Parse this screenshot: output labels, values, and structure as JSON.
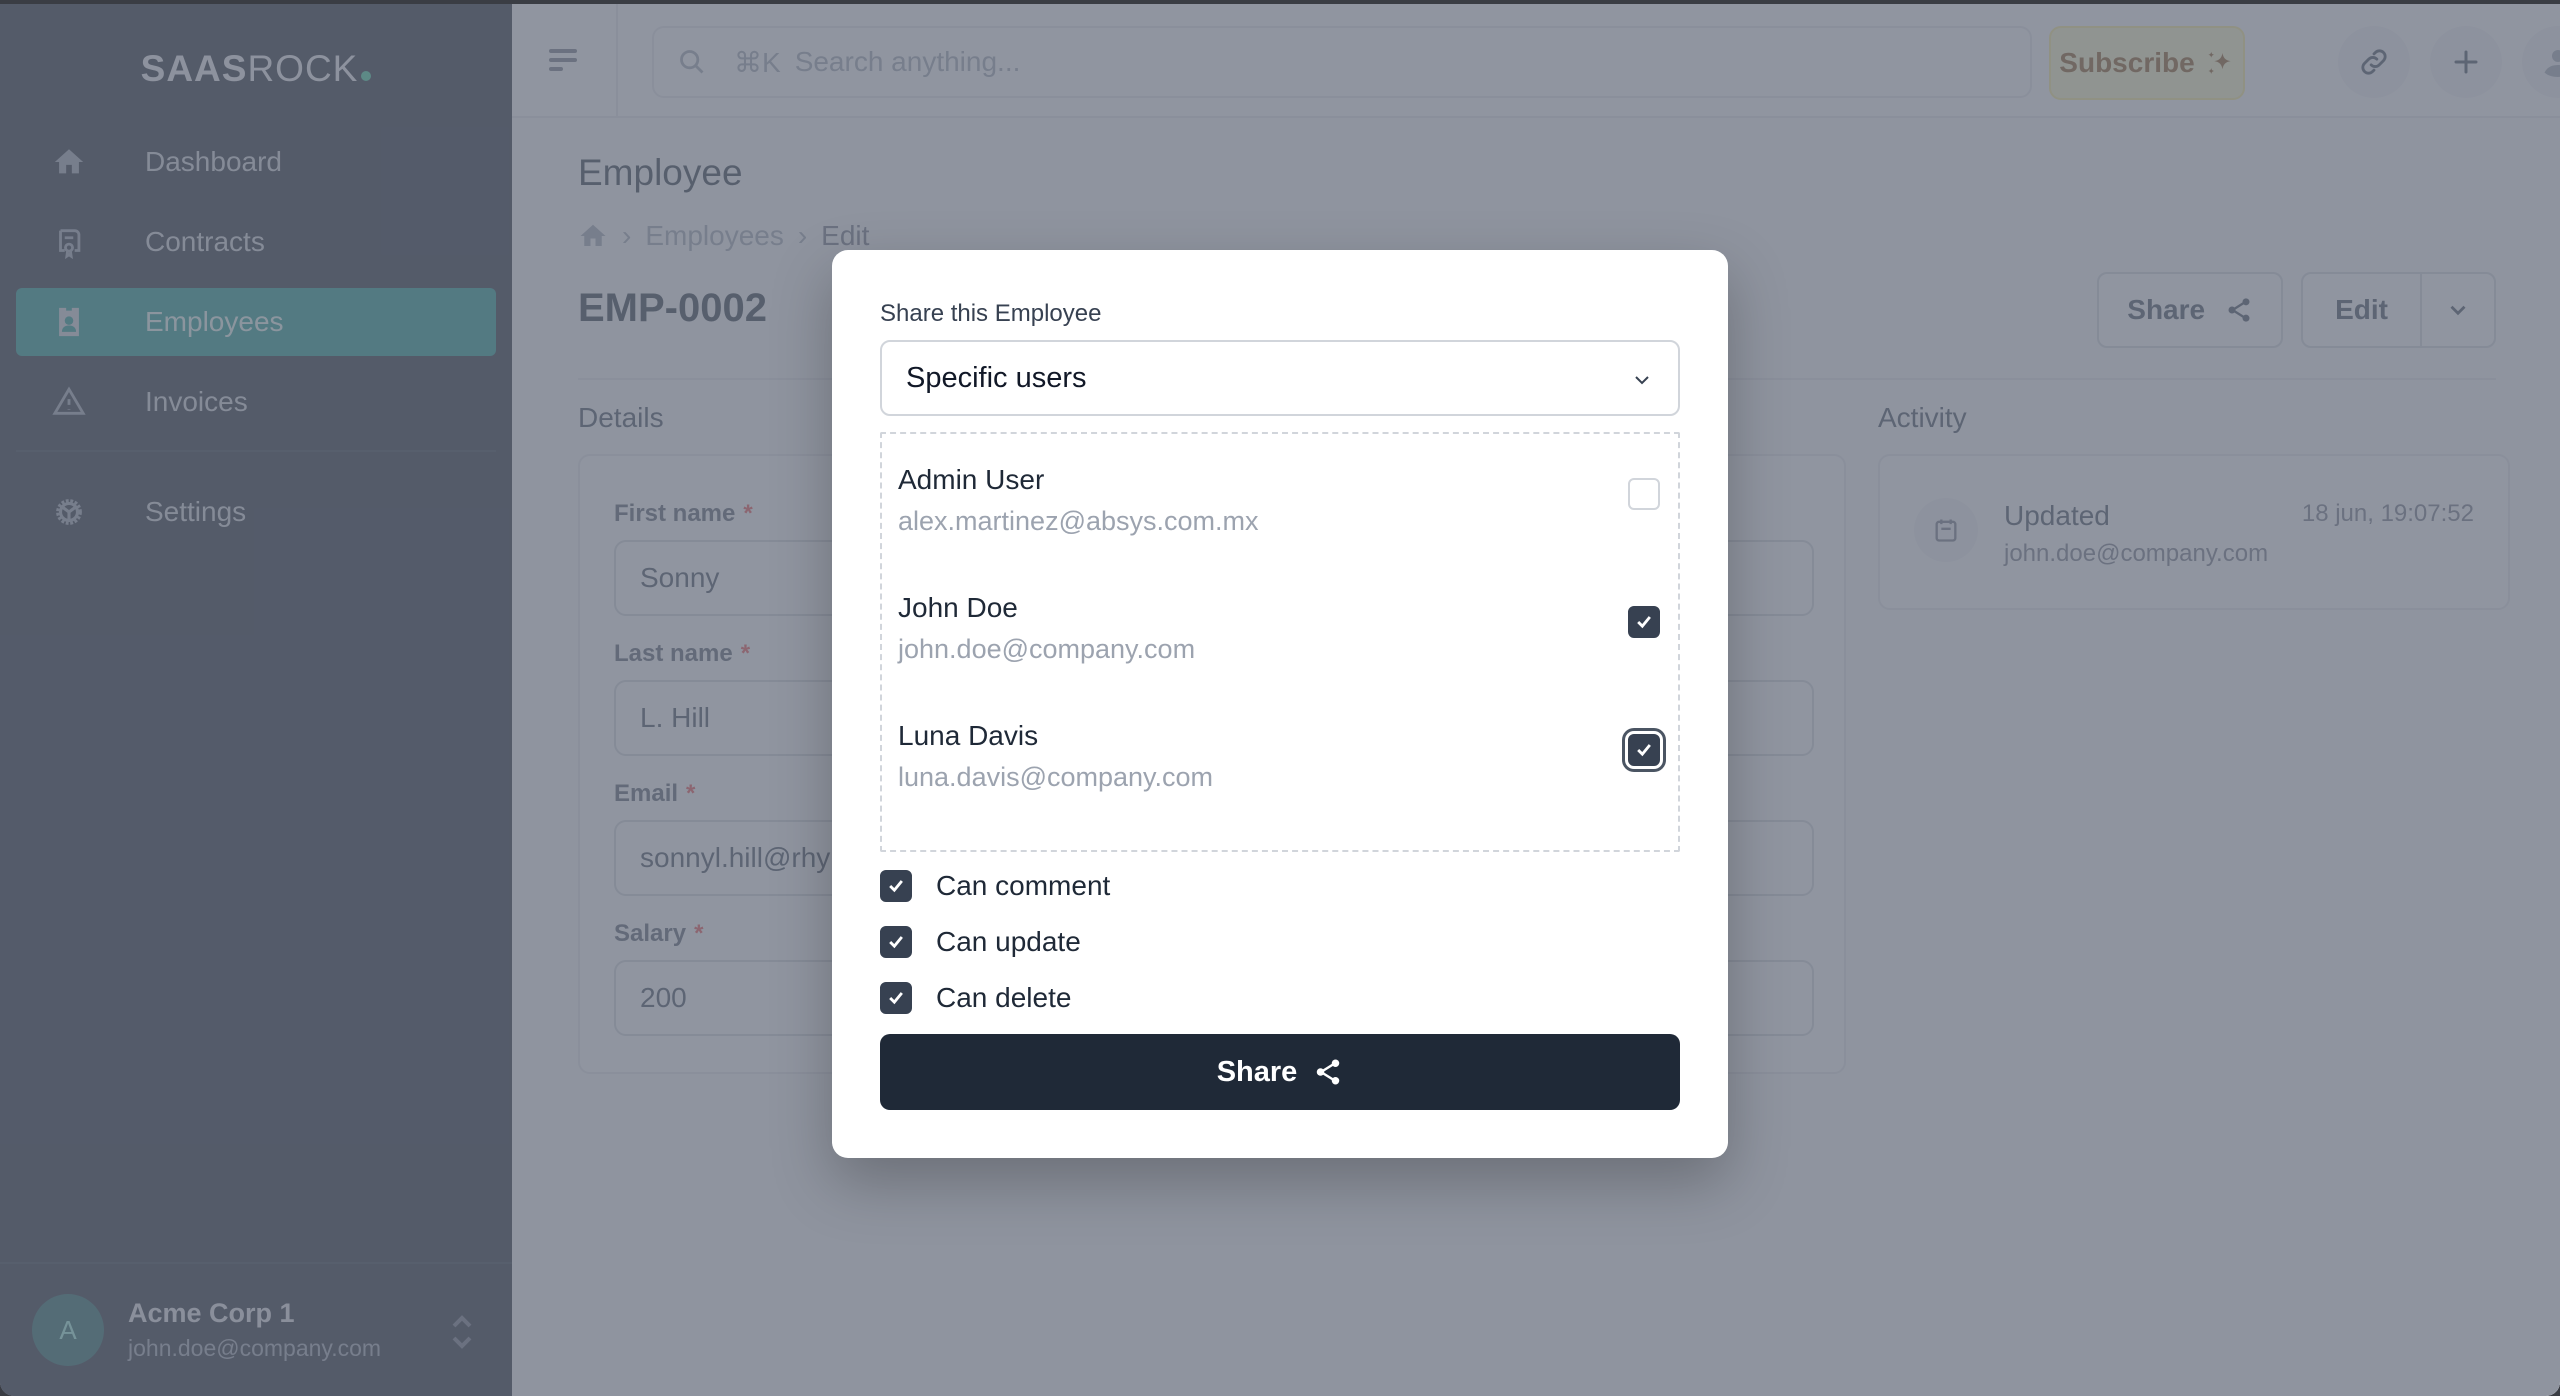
{
  "brand": {
    "bold": "SAAS",
    "light": "ROCK"
  },
  "sidebar": {
    "items": [
      {
        "label": "Dashboard",
        "icon": "home-icon",
        "active": false
      },
      {
        "label": "Contracts",
        "icon": "contract-icon",
        "active": false
      },
      {
        "label": "Employees",
        "icon": "id-badge-icon",
        "active": true
      },
      {
        "label": "Invoices",
        "icon": "warning-icon",
        "active": false
      }
    ],
    "settings": {
      "label": "Settings",
      "icon": "gear-icon"
    },
    "profile": {
      "initial": "A",
      "org": "Acme Corp 1",
      "email": "john.doe@company.com"
    }
  },
  "topbar": {
    "search_shortcut": "⌘K",
    "search_placeholder": "Search anything...",
    "subscribe_label": "Subscribe"
  },
  "page": {
    "title": "Employee",
    "breadcrumb": [
      "Employees",
      "Edit"
    ],
    "record_id": "EMP-0002",
    "actions": {
      "share_label": "Share",
      "edit_label": "Edit"
    },
    "details": {
      "title": "Details",
      "fields": [
        {
          "label": "First name",
          "required": "*",
          "value": "Sonny"
        },
        {
          "label": "Last name",
          "required": "*",
          "value": "L. Hill"
        },
        {
          "label": "Email",
          "required": "*",
          "value": "sonnyl.hill@rhy"
        },
        {
          "label": "Salary",
          "required": "*",
          "value": "200"
        }
      ]
    },
    "activity": {
      "title": "Activity",
      "items": [
        {
          "action": "Updated",
          "user": "john.doe@company.com",
          "time": "18 jun, 19:07:52"
        }
      ]
    }
  },
  "modal": {
    "label": "Share this Employee",
    "select_value": "Specific users",
    "users": [
      {
        "name": "Admin User",
        "email": "alex.martinez@absys.com.mx",
        "checked": false
      },
      {
        "name": "John Doe",
        "email": "john.doe@company.com",
        "checked": true
      },
      {
        "name": "Luna Davis",
        "email": "luna.davis@company.com",
        "checked": true
      }
    ],
    "permissions": [
      {
        "label": "Can comment",
        "checked": true
      },
      {
        "label": "Can update",
        "checked": true
      },
      {
        "label": "Can delete",
        "checked": true
      }
    ],
    "share_label": "Share"
  },
  "colors": {
    "accent": "#0d9488",
    "primary_button": "#1f2937",
    "checkbox_checked": "#374151",
    "overlay": "#6b7280"
  }
}
